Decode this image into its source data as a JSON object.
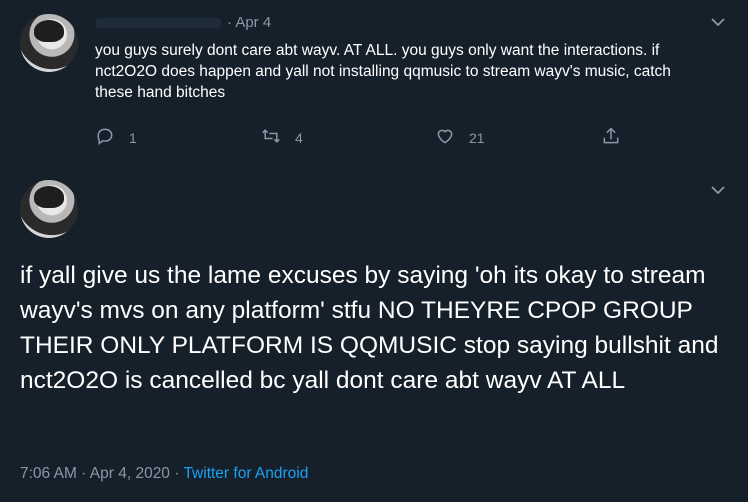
{
  "tweet1": {
    "date": "· Apr 4",
    "text": "you guys surely dont care abt wayv. AT ALL. you guys only want the interactions. if nct2O2O does happen and yall not installing qqmusic to stream wayv's music, catch these hand bitches",
    "replies": "1",
    "retweets": "4",
    "likes": "21"
  },
  "tweet2": {
    "text": "if yall give us the lame excuses by saying 'oh its okay to stream wayv's mvs on any platform' stfu NO THEYRE CPOP GROUP THEIR ONLY PLATFORM IS QQMUSIC stop saying bullshit and nct2O2O is cancelled bc yall dont care abt wayv AT ALL",
    "time": "7:06 AM · Apr 4, 2020 · ",
    "source": "Twitter for Android"
  },
  "colors": {
    "background": "#15202b",
    "text": "#ffffff",
    "muted": "#8899a6",
    "link": "#1da1f2",
    "divider": "#38444d"
  },
  "icons": [
    "reply-icon",
    "retweet-icon",
    "like-icon",
    "share-icon",
    "chevron-down-icon"
  ]
}
